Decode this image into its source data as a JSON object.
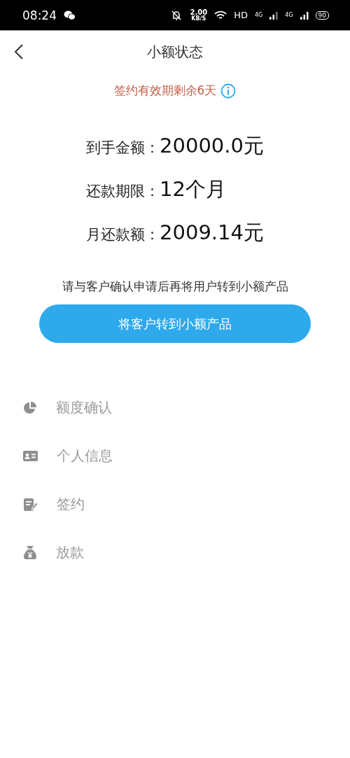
{
  "status_bar": {
    "time": "08:24",
    "speed_value": "2.00",
    "speed_unit": "KB/S",
    "hd": "HD",
    "network_1": "4G",
    "network_2": "4G",
    "battery": "90"
  },
  "header": {
    "title": "小额状态"
  },
  "notice": {
    "text": "签约有效期剩余6天"
  },
  "amounts": [
    {
      "label": "到手金额：",
      "value": "20000.0元"
    },
    {
      "label": "还款期限：",
      "value": "12个月"
    },
    {
      "label": "月还款额：",
      "value": "2009.14元"
    }
  ],
  "instruction": "请与客户确认申请后再将用户转到小额产品",
  "primary_button": "将客户转到小额产品",
  "steps": [
    {
      "kind": "quota",
      "label": "额度确认"
    },
    {
      "kind": "profile",
      "label": "个人信息"
    },
    {
      "kind": "sign",
      "label": "签约"
    },
    {
      "kind": "payout",
      "label": "放款"
    }
  ]
}
